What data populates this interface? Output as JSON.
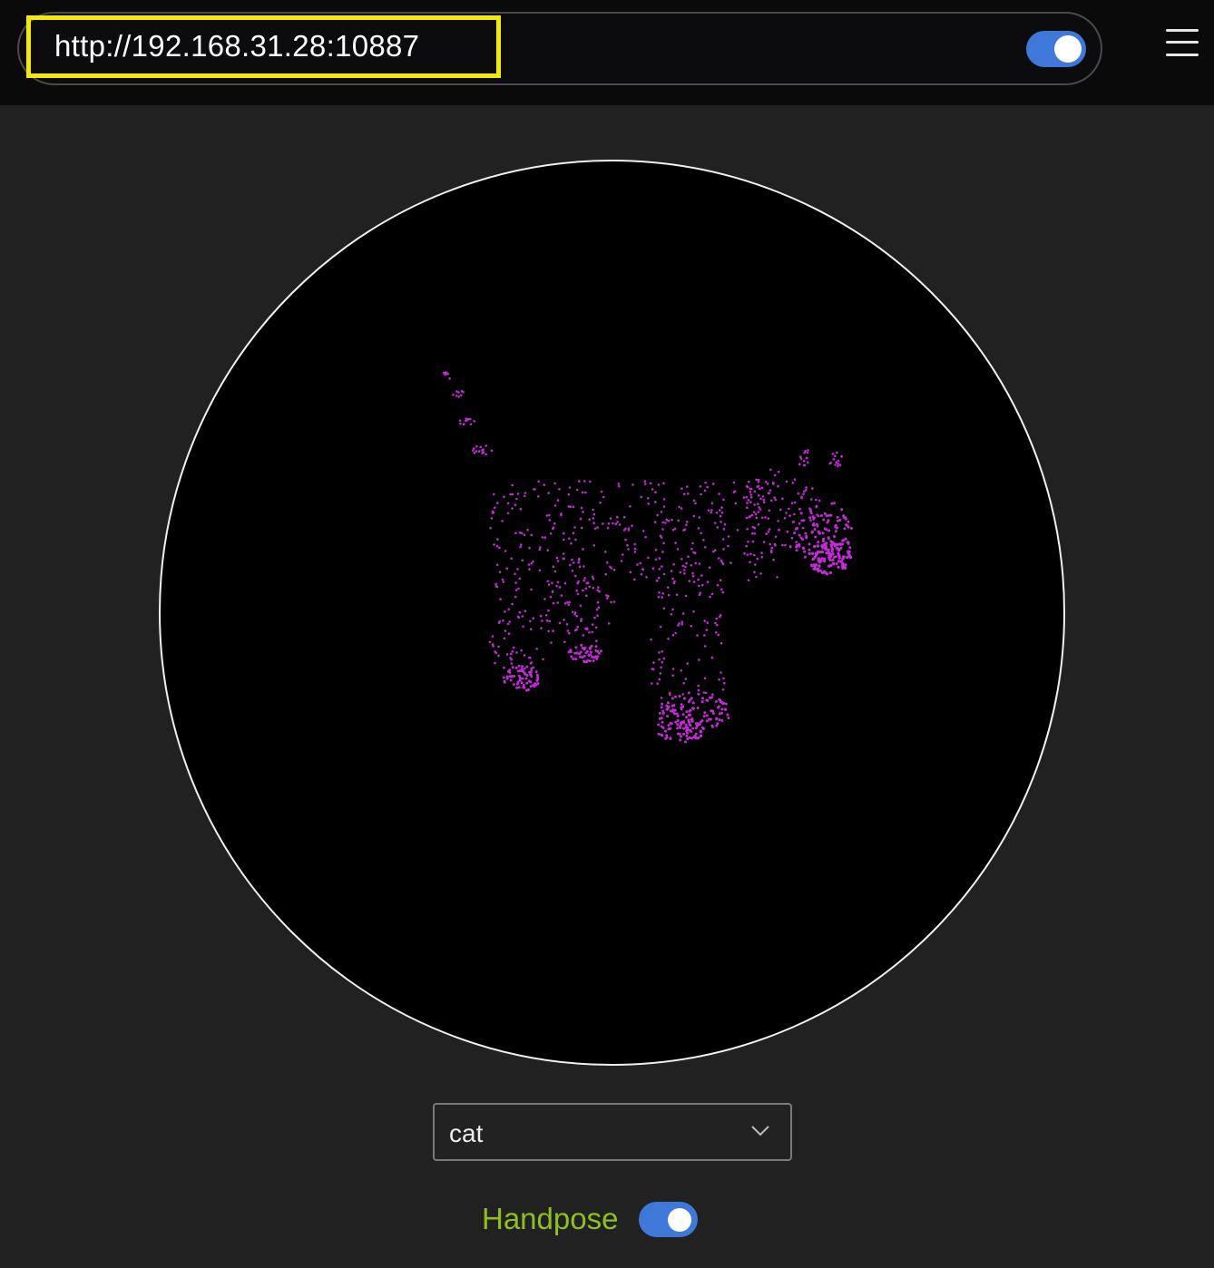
{
  "header": {
    "url": "http://192.168.31.28:10887",
    "url_toggle_on": true,
    "menu_icon": "hamburger-menu-icon"
  },
  "viewer": {
    "content": "point-cloud",
    "point_color": "#c32bd6",
    "border_color": "#f0f0f0",
    "background": "#000000"
  },
  "model_select": {
    "selected": "cat",
    "icon": "chevron-down-icon"
  },
  "handpose": {
    "label": "Handpose",
    "label_color": "#8fbf1f",
    "enabled": true
  },
  "colors": {
    "toggle_on": "#3f78d8",
    "highlight": "#f3ea00",
    "page_bg": "#212121",
    "topbar_bg": "#0a0a0b"
  }
}
